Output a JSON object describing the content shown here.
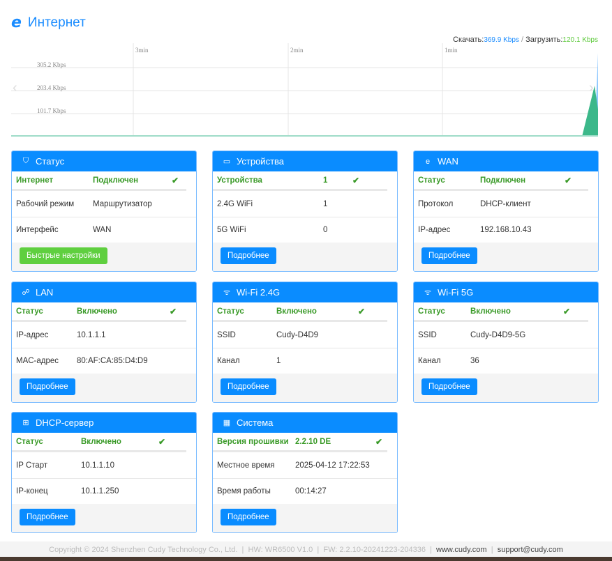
{
  "page": {
    "title": "Интернет",
    "icon": "ie-icon"
  },
  "rates": {
    "download_label": "Скачать:",
    "download": "369.9 Kbps",
    "separator": "/",
    "upload_label": "Загрузить:",
    "upload": "120.1 Kbps"
  },
  "chart_data": {
    "type": "area",
    "x_ticks": [
      "3min",
      "2min",
      "1min"
    ],
    "y_ticks": [
      "305.2 Kbps",
      "203.4 Kbps",
      "101.7 Kbps"
    ],
    "series": [
      {
        "name": "Скачать",
        "color": "#8ec8ff",
        "last_values": [
          0,
          0,
          369.9
        ]
      },
      {
        "name": "Загрузить",
        "color": "#3cb88a",
        "last_values": [
          0,
          225,
          120.1
        ]
      }
    ]
  },
  "cards": [
    {
      "id": "status",
      "title": "Статус",
      "icon": "router-icon",
      "glyph": "⛉",
      "cols": "110px 113px 1fr",
      "first": [
        "Интернет",
        "Подключен"
      ],
      "rows": [
        [
          "Рабочий режим",
          "Маршрутизатор"
        ],
        [
          "Интерфейс",
          "WAN"
        ]
      ],
      "button": "Быстрые настройки",
      "green": true
    },
    {
      "id": "devices",
      "title": "Устройства",
      "icon": "devices-icon",
      "glyph": "▭",
      "cols": "152px 42px 1fr",
      "first": [
        "Устройства",
        "1"
      ],
      "rows": [
        [
          "2.4G WiFi",
          "1"
        ],
        [
          "5G WiFi",
          "0"
        ]
      ],
      "button": "Подробнее"
    },
    {
      "id": "wan",
      "title": "WAN",
      "icon": "ie-icon",
      "glyph": "e",
      "cols": "89px 121px 1fr",
      "first": [
        "Статус",
        "Подключен"
      ],
      "rows": [
        [
          "Протокол",
          "DHCP-клиент"
        ],
        [
          "IP-адрес",
          "192.168.10.43"
        ]
      ],
      "button": "Подробнее"
    },
    {
      "id": "lan",
      "title": "LAN",
      "icon": "network-icon",
      "glyph": "☍",
      "cols": "87px 133px 1fr",
      "first": [
        "Статус",
        "Включено"
      ],
      "rows": [
        [
          "IP-адрес",
          "10.1.1.1"
        ],
        [
          "MAC-адрес",
          "80:AF:CA:85:D4:D9"
        ]
      ],
      "button": "Подробнее"
    },
    {
      "id": "wifi24",
      "title": "Wi-Fi 2.4G",
      "icon": "wifi-icon",
      "glyph": "ᯤ",
      "cols": "85px 117px 1fr",
      "first": [
        "Статус",
        "Включено"
      ],
      "rows": [
        [
          "SSID",
          "Cudy-D4D9"
        ],
        [
          "Канал",
          "1"
        ]
      ],
      "button": "Подробнее"
    },
    {
      "id": "wifi5",
      "title": "Wi-Fi 5G",
      "icon": "wifi-icon",
      "glyph": "ᯤ",
      "cols": "75px 133px 1fr",
      "first": [
        "Статус",
        "Включено"
      ],
      "rows": [
        [
          "SSID",
          "Cudy-D4D9-5G"
        ],
        [
          "Канал",
          "36"
        ]
      ],
      "button": "Подробнее"
    },
    {
      "id": "dhcp",
      "title": "DHCP-сервер",
      "icon": "dhcp-icon",
      "glyph": "⊞",
      "cols": "93px 111px 1fr",
      "first": [
        "Статус",
        "Включено"
      ],
      "rows": [
        [
          "IP Старт",
          "10.1.1.10"
        ],
        [
          "IP-конец",
          "10.1.1.250"
        ]
      ],
      "button": "Подробнее"
    },
    {
      "id": "system",
      "title": "Система",
      "icon": "system-icon",
      "glyph": "▦",
      "cols": "112px 115px 1fr",
      "first": [
        "Версия прошивки",
        "2.2.10 DE"
      ],
      "rows": [
        [
          "Местное время",
          "2025-04-12 17:22:53"
        ],
        [
          "Время работы",
          "00:14:27"
        ]
      ],
      "button": "Подробнее"
    }
  ],
  "footer": {
    "copyright": "Copyright © 2024 Shenzhen Cudy Technology Co., Ltd.",
    "hw": "HW: WR6500 V1.0",
    "fw": "FW: 2.2.10-20241223-204336",
    "site": "www.cudy.com",
    "email": "support@cudy.com",
    "sep": "|"
  }
}
